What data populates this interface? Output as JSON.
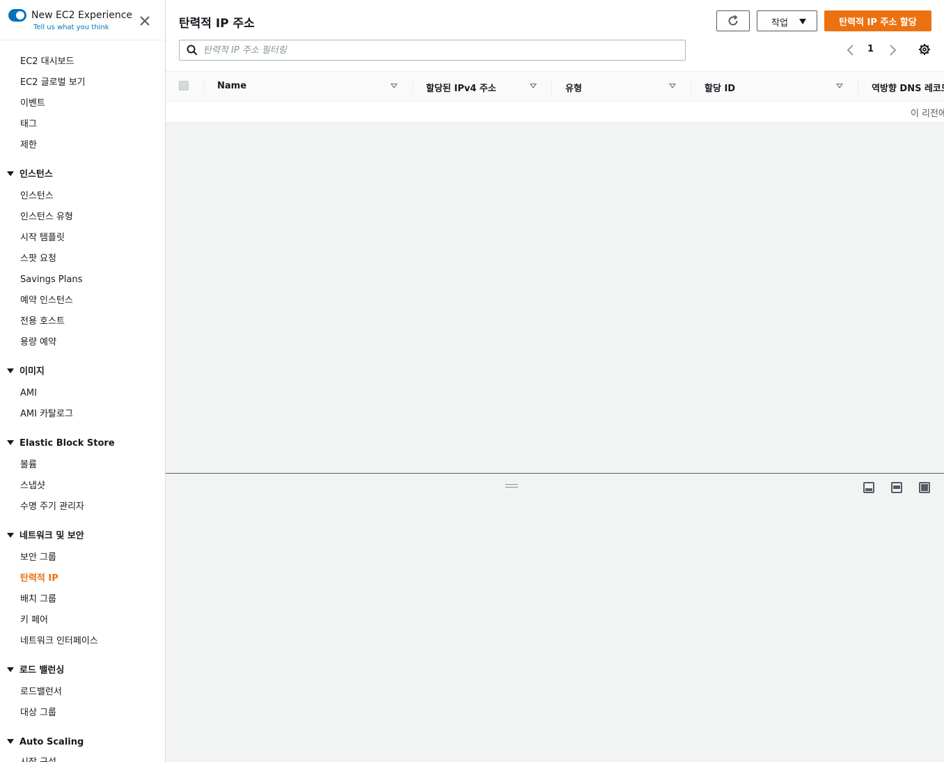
{
  "experience": {
    "title": "New EC2 Experience",
    "link": "Tell us what you think"
  },
  "sidebar": {
    "top_items": [
      {
        "label": "EC2 대시보드"
      },
      {
        "label": "EC2 글로벌 보기"
      },
      {
        "label": "이벤트"
      },
      {
        "label": "태그"
      },
      {
        "label": "제한"
      }
    ],
    "sections": [
      {
        "title": "인스턴스",
        "items": [
          "인스턴스",
          "인스턴스 유형",
          "시작 템플릿",
          "스팟 요청",
          "Savings Plans",
          "예약 인스턴스",
          "전용 호스트",
          "용량 예약"
        ]
      },
      {
        "title": "이미지",
        "items": [
          "AMI",
          "AMI 카탈로그"
        ]
      },
      {
        "title": "Elastic Block Store",
        "items": [
          "볼륨",
          "스냅샷",
          "수명 주기 관리자"
        ]
      },
      {
        "title": "네트워크 및 보안",
        "items": [
          "보안 그룹",
          "탄력적 IP",
          "배치 그룹",
          "키 페어",
          "네트워크 인터페이스"
        ]
      },
      {
        "title": "로드 밸런싱",
        "items": [
          "로드밸런서",
          "대상 그룹"
        ]
      },
      {
        "title": "Auto Scaling",
        "items": [
          "시작 구성"
        ]
      }
    ],
    "active_item": "탄력적 IP"
  },
  "header": {
    "title": "탄력적 IP 주소",
    "actions_label": "작업",
    "allocate_label": "탄력적 IP 주소 할당",
    "accent_color": "#ec7211"
  },
  "search": {
    "placeholder": "탄력적 IP 주소 필터링",
    "value": ""
  },
  "pagination": {
    "current_page": "1"
  },
  "table": {
    "columns": [
      "Name",
      "할당된 IPv4 주소",
      "유형",
      "할당 ID",
      "역방향 DNS 레코드"
    ],
    "empty_message": "이 리전에"
  }
}
